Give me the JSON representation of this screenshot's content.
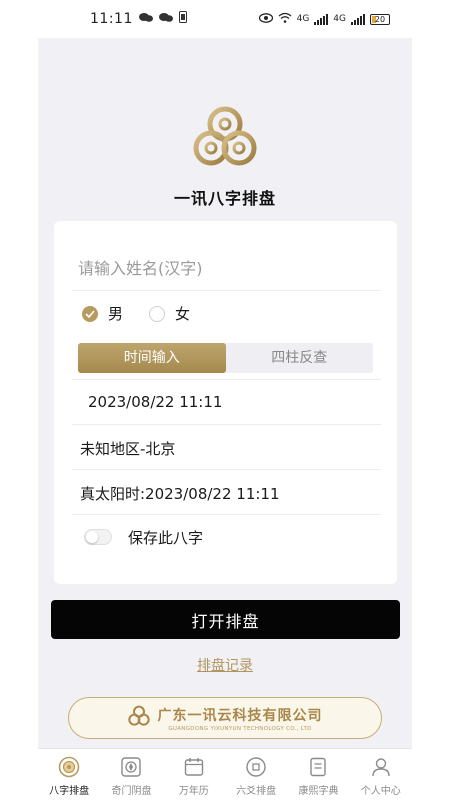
{
  "status_bar": {
    "time": "11:11",
    "battery": "20",
    "network_label": "4G"
  },
  "app": {
    "title": "一讯八字排盘",
    "brand_color": "#b79a5f"
  },
  "form": {
    "name_placeholder": "请输入姓名(汉字)",
    "name_value": "",
    "gender": {
      "male_label": "男",
      "female_label": "女",
      "selected": "男"
    },
    "tabs": [
      {
        "label": "时间输入",
        "active": true
      },
      {
        "label": "四柱反查",
        "active": false
      }
    ],
    "datetime": "2023/08/22 11:11",
    "region": "未知地区-北京",
    "true_solar_time": "真太阳时:2023/08/22 11:11",
    "save_toggle_label": "保存此八字",
    "save_toggle_on": false
  },
  "actions": {
    "open_chart_label": "打开排盘",
    "history_label": "排盘记录"
  },
  "company": {
    "name": "广东一讯云科技有限公司",
    "name_en": "GUANGDONG YIXUNYUN TECHNOLOGY CO., LTD"
  },
  "bottom_nav": [
    {
      "label": "八字排盘",
      "icon": "bagua-icon",
      "active": true
    },
    {
      "label": "奇门阴盘",
      "icon": "compass-icon",
      "active": false
    },
    {
      "label": "万年历",
      "icon": "calendar-icon",
      "active": false
    },
    {
      "label": "六爻排盘",
      "icon": "coin-icon",
      "active": false
    },
    {
      "label": "康熙字典",
      "icon": "book-icon",
      "active": false
    },
    {
      "label": "个人中心",
      "icon": "user-icon",
      "active": false
    }
  ]
}
